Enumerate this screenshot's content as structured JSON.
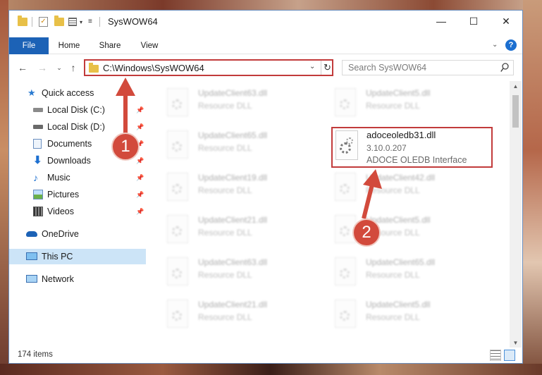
{
  "window": {
    "title": "SysWOW64",
    "minimize_glyph": "—",
    "maximize_glyph": "☐",
    "close_glyph": "✕"
  },
  "ribbon": {
    "tabs": [
      {
        "label": "File"
      },
      {
        "label": "Home"
      },
      {
        "label": "Share"
      },
      {
        "label": "View"
      }
    ],
    "help": "?"
  },
  "address": {
    "path": "C:\\Windows\\SysWOW64",
    "search_placeholder": "Search SysWOW64"
  },
  "navpane": {
    "items": [
      {
        "label": "Quick access",
        "icon": "star-icon",
        "pinned": false
      },
      {
        "label": "Local Disk (C:)",
        "icon": "drive-icon",
        "pinned": true
      },
      {
        "label": "Local Disk (D:)",
        "icon": "drive-icon",
        "pinned": true
      },
      {
        "label": "Documents",
        "icon": "documents-icon",
        "pinned": true
      },
      {
        "label": "Downloads",
        "icon": "download-icon",
        "pinned": true
      },
      {
        "label": "Music",
        "icon": "music-icon",
        "pinned": true
      },
      {
        "label": "Pictures",
        "icon": "pictures-icon",
        "pinned": true
      },
      {
        "label": "Videos",
        "icon": "videos-icon",
        "pinned": true
      },
      {
        "label": "OneDrive",
        "icon": "cloud-icon",
        "pinned": false
      },
      {
        "label": "This PC",
        "icon": "computer-icon",
        "pinned": false
      },
      {
        "label": "Network",
        "icon": "network-icon",
        "pinned": false
      }
    ]
  },
  "files": {
    "column_left": [
      {
        "name": "UpdateClient63.dll",
        "type": "Resource DLL"
      },
      {
        "name": "UpdateClient65.dll",
        "type": "Resource DLL"
      },
      {
        "name": "UpdateClient19.dll",
        "type": "Resource DLL"
      },
      {
        "name": "UpdateClient21.dll",
        "type": "Resource DLL"
      },
      {
        "name": "UpdateClient63.dll",
        "type": "Resource DLL"
      },
      {
        "name": "UpdateClient21.dll",
        "type": "Resource DLL"
      }
    ],
    "column_right": [
      {
        "name": "UpdateClient5.dll",
        "type": "Resource DLL"
      },
      {
        "name": "UpdateClient42.dll",
        "type": "Resource DLL"
      },
      {
        "name": "UpdateClient5.dll",
        "type": "Resource DLL"
      },
      {
        "name": "UpdateClient65.dll",
        "type": "Resource DLL"
      },
      {
        "name": "UpdateClient5.dll",
        "type": "Resource DLL"
      }
    ],
    "highlighted": {
      "name": "adoceoledb31.dll",
      "version": "3.10.0.207",
      "description": "ADOCE OLEDB Interface"
    }
  },
  "status": {
    "item_count": "174 items"
  },
  "callouts": [
    {
      "number": "1"
    },
    {
      "number": "2"
    }
  ],
  "colors": {
    "accent": "#1c62b6",
    "callout": "#d24a3c",
    "highlight_border": "#c23b3b",
    "selected": "#cce4f7"
  }
}
